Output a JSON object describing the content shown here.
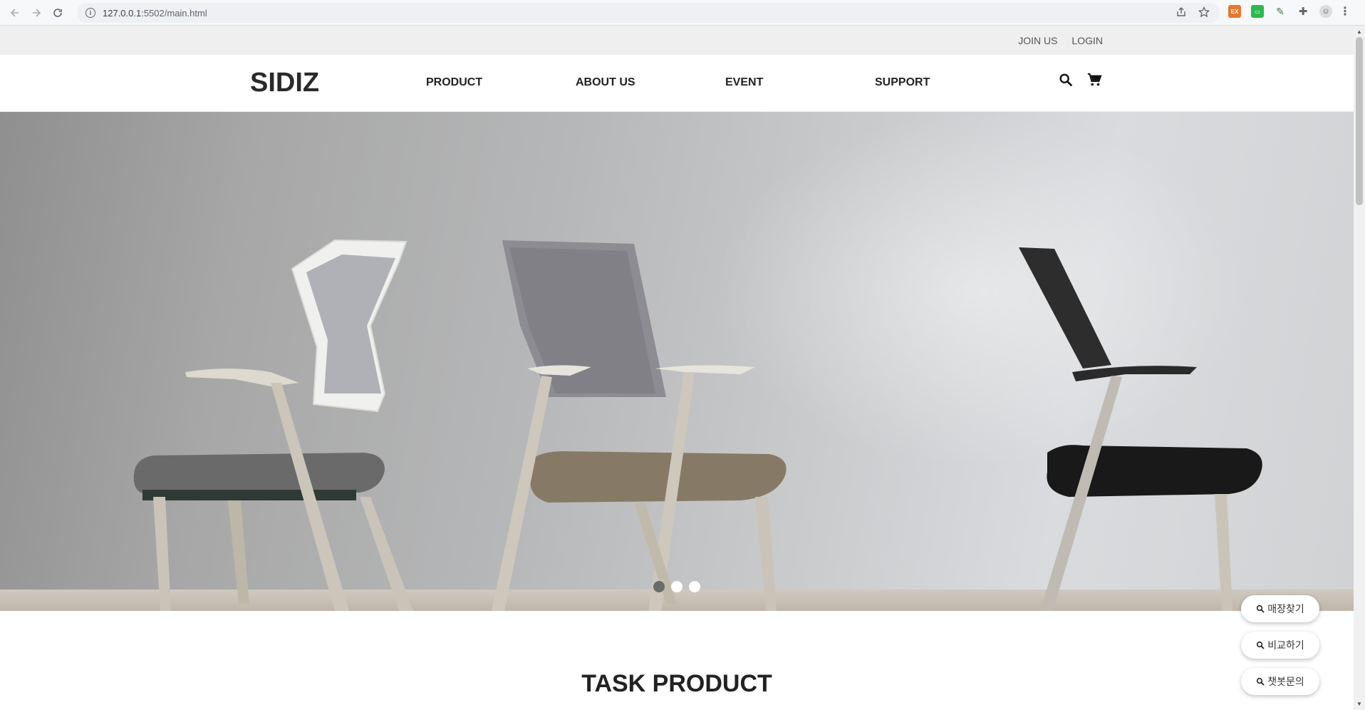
{
  "browser": {
    "url_host": "127.0.0.1",
    "url_path": ":5502/main.html"
  },
  "topbar": {
    "join_label": "JOIN US",
    "login_label": "LOGIN"
  },
  "header": {
    "logo": "SIDIZ",
    "nav": [
      "PRODUCT",
      "ABOUT US",
      "EVENT",
      "SUPPORT"
    ],
    "icons": [
      "search-icon",
      "cart-icon"
    ]
  },
  "hero": {
    "slide_count": 3,
    "active_slide": 1
  },
  "section": {
    "title": "TASK PRODUCT"
  },
  "floating": {
    "buttons": [
      "매장찾기",
      "비교하기",
      "챗봇문의"
    ]
  },
  "colors": {
    "topbar_bg": "#efefef",
    "text": "#222222",
    "dot_active": "#6a6a6a"
  }
}
